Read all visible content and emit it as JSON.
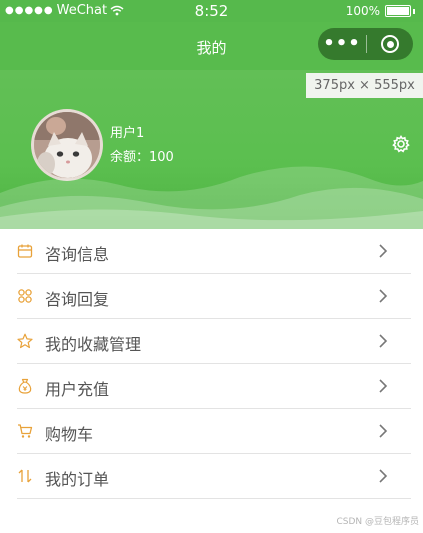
{
  "status_bar": {
    "carrier": "WeChat",
    "time": "8:52",
    "battery": "100%"
  },
  "nav": {
    "title": "我的"
  },
  "size_tag": "375px × 555px",
  "profile": {
    "username": "用户1",
    "balance": "余额：100"
  },
  "menu": {
    "items": [
      {
        "label": "咨询信息",
        "icon": "calendar-icon"
      },
      {
        "label": "咨询回复",
        "icon": "grid-icon"
      },
      {
        "label": "我的收藏管理",
        "icon": "star-icon"
      },
      {
        "label": "用户充值",
        "icon": "money-bag-icon"
      },
      {
        "label": "购物车",
        "icon": "cart-icon"
      },
      {
        "label": "我的订单",
        "icon": "sort-arrows-icon"
      }
    ]
  },
  "watermark": "CSDN @豆包程序员",
  "colors": {
    "primary_green": "#58bb4d",
    "icon_orange": "#e8a23a",
    "text": "#555555"
  }
}
